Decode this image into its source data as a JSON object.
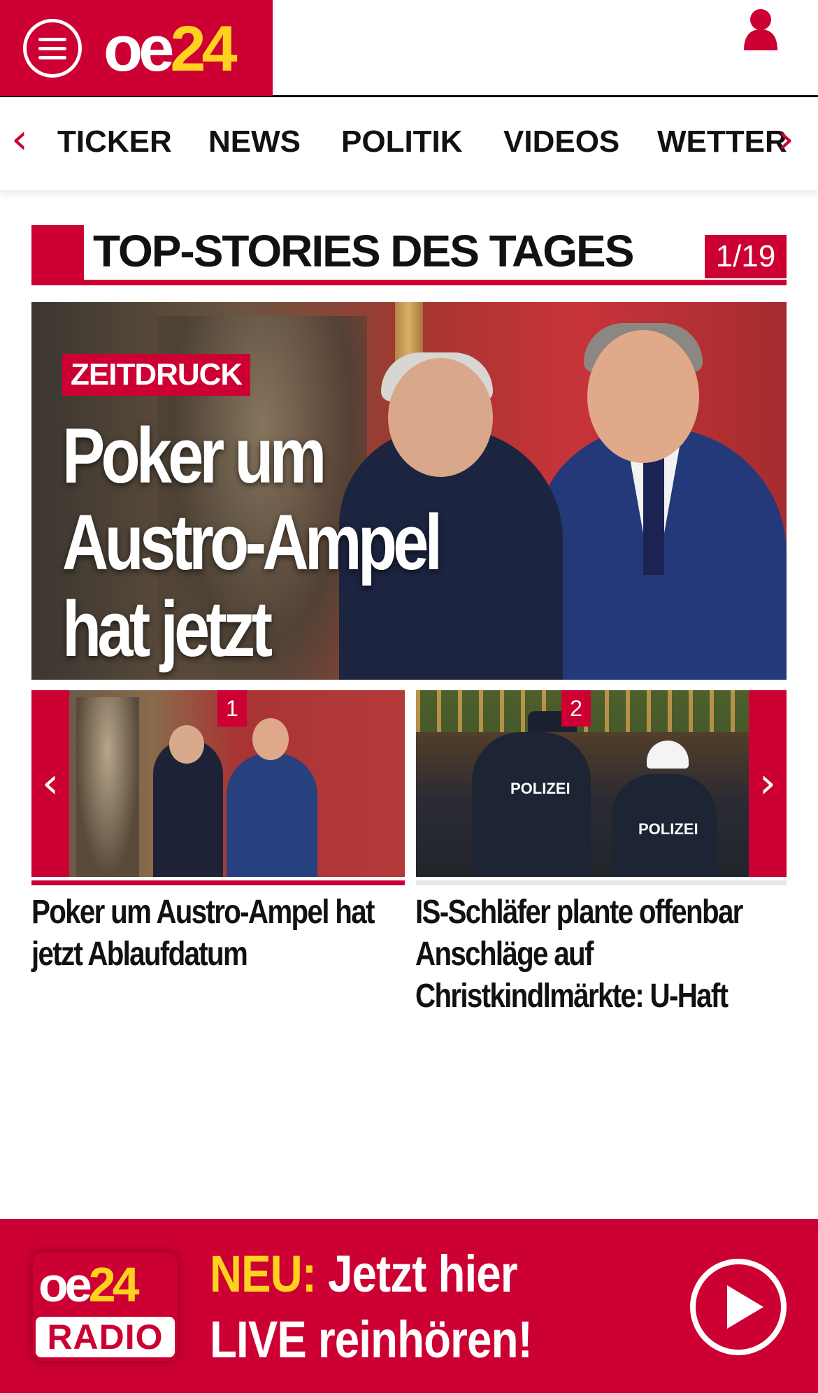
{
  "header": {
    "brand_oe": "oe",
    "brand_num": "24",
    "menu_icon": "hamburger-menu-icon",
    "user_icon": "user-icon"
  },
  "nav": {
    "items": [
      "TICKER",
      "NEWS",
      "POLITIK",
      "VIDEOS",
      "WETTER"
    ],
    "left_arrow": "‹",
    "right_arrow": "›"
  },
  "section": {
    "title": "TOP-STORIES DES TAGES",
    "counter": "1/19"
  },
  "hero": {
    "kicker": "ZEITDRUCK",
    "headline_line1": "Poker um",
    "headline_line2": "Austro-Ampel",
    "headline_line3": "hat jetzt Ablaufdatum"
  },
  "carousel": {
    "left_arrow": "‹",
    "right_arrow": "›",
    "items": [
      {
        "badge": "1",
        "caption": "Poker um Austro-Ampel hat jetzt Ablaufdatum",
        "active": true
      },
      {
        "badge": "2",
        "caption": "IS-Schläfer plante offenbar Anschläge auf Christkindlmärkte: U-Haft",
        "active": false,
        "image_text_1": "POLIZEI",
        "image_text_2": "POLIZEI"
      }
    ]
  },
  "radio": {
    "logo_oe": "oe",
    "logo_num": "24",
    "logo_radio": "RADIO",
    "neu": "NEU:",
    "line1_rest": " Jetzt hier",
    "line2": "LIVE reinhören!",
    "play_icon": "play-icon"
  },
  "colors": {
    "brand_red": "#cc0033",
    "brand_yellow": "#ffd21f",
    "text": "#111111"
  }
}
